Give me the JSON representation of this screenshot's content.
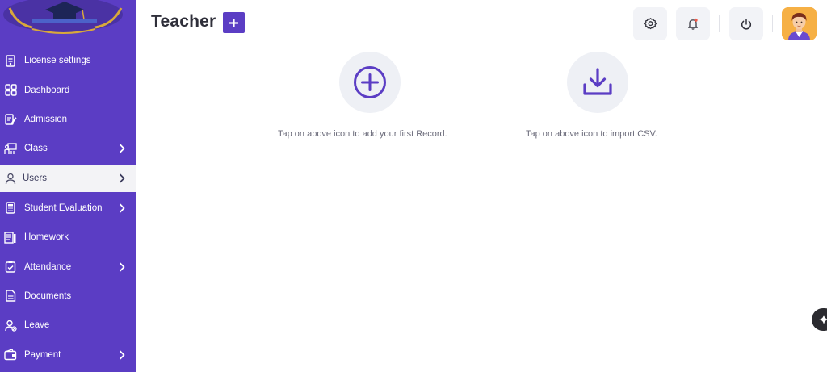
{
  "sidebar": {
    "items": [
      {
        "label": "License settings",
        "icon": "license-icon",
        "has_submenu": false,
        "active": false
      },
      {
        "label": "Dashboard",
        "icon": "dashboard-grid-icon",
        "has_submenu": false,
        "active": false
      },
      {
        "label": "Admission",
        "icon": "admission-edit-icon",
        "has_submenu": false,
        "active": false
      },
      {
        "label": "Class",
        "icon": "class-teacher-icon",
        "has_submenu": true,
        "active": false
      },
      {
        "label": "Users",
        "icon": "user-icon",
        "has_submenu": true,
        "active": true
      },
      {
        "label": "Student Evaluation",
        "icon": "calculator-icon",
        "has_submenu": true,
        "active": false
      },
      {
        "label": "Homework",
        "icon": "homework-icon",
        "has_submenu": false,
        "active": false
      },
      {
        "label": "Attendance",
        "icon": "clipboard-check-icon",
        "has_submenu": true,
        "active": false
      },
      {
        "label": "Documents",
        "icon": "document-icon",
        "has_submenu": false,
        "active": false
      },
      {
        "label": "Leave",
        "icon": "leave-user-icon",
        "has_submenu": false,
        "active": false
      },
      {
        "label": "Payment",
        "icon": "wallet-icon",
        "has_submenu": true,
        "active": false
      }
    ]
  },
  "header": {
    "title": "Teacher",
    "add_icon": "plus-icon",
    "buttons": [
      "settings-gear-icon",
      "notification-bell-icon",
      "power-icon"
    ],
    "avatar": "user-avatar"
  },
  "main": {
    "add_record_text": "Tap on above icon to add your first Record.",
    "import_csv_text": "Tap on above icon to import CSV."
  },
  "colors": {
    "sidebar_bg": "#5b3dc4",
    "accent": "#5b3dc4",
    "active_item_bg": "#f3f3f6",
    "icon_circle_bg": "#eef0f5",
    "avatar_bg": "#f6b045"
  }
}
